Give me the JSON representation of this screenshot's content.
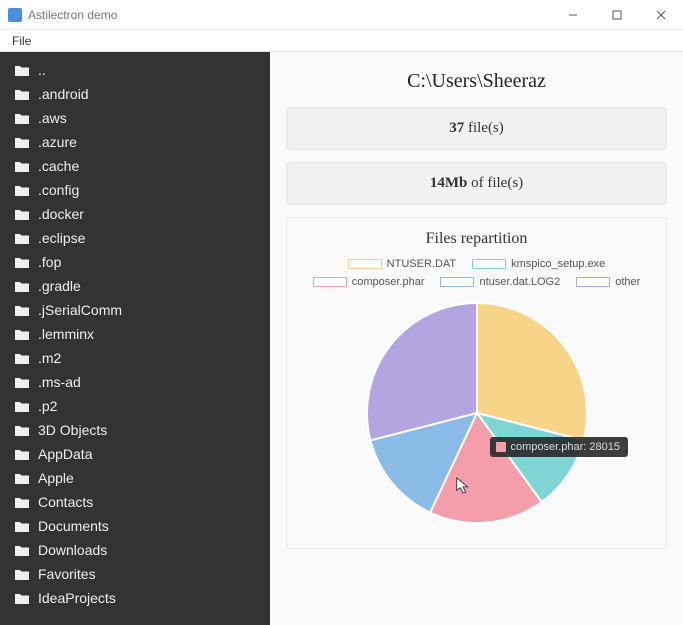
{
  "window": {
    "title": "Astilectron demo",
    "menu": {
      "file": "File"
    }
  },
  "sidebar": {
    "items": [
      "..",
      ".android",
      ".aws",
      ".azure",
      ".cache",
      ".config",
      ".docker",
      ".eclipse",
      ".fop",
      ".gradle",
      ".jSerialComm",
      ".lemminx",
      ".m2",
      ".ms-ad",
      ".p2",
      "3D Objects",
      "AppData",
      "Apple",
      "Contacts",
      "Documents",
      "Downloads",
      "Favorites",
      "IdeaProjects"
    ]
  },
  "main": {
    "path": "C:\\Users\\Sheeraz",
    "file_count_num": "37",
    "file_count_suffix": " file(s)",
    "size_num": "14Mb",
    "size_suffix": " of file(s)"
  },
  "chart_data": {
    "type": "pie",
    "title": "Files repartition",
    "series": [
      {
        "name": "NTUSER.DAT",
        "value": 29,
        "color": "#f7d487"
      },
      {
        "name": "kmspico_setup.exe",
        "value": 11,
        "color": "#7fd4d4"
      },
      {
        "name": "composer.phar",
        "value": 17,
        "color": "#f39eaa"
      },
      {
        "name": "ntuser.dat.LOG2",
        "value": 14,
        "color": "#8bbce8"
      },
      {
        "name": "other",
        "value": 29,
        "color": "#b3a5df"
      }
    ],
    "tooltip": {
      "label": "composer.phar: 28015",
      "color": "#f39eaa"
    }
  }
}
